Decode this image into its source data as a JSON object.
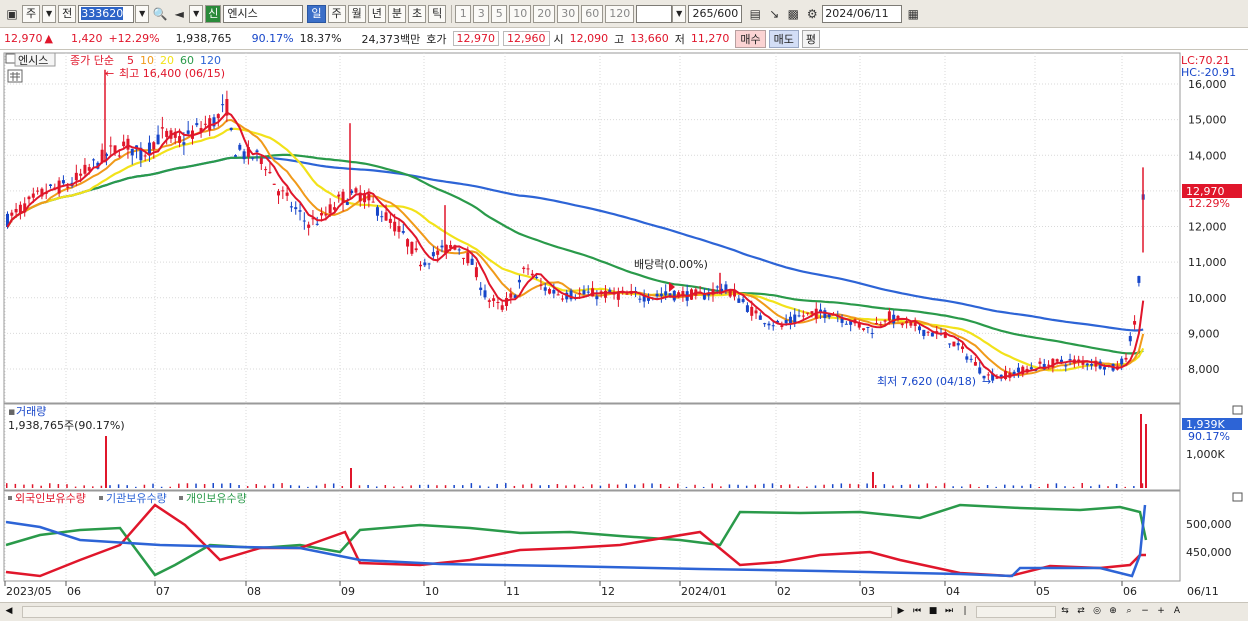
{
  "toolbar": {
    "period_label": "주",
    "prev_label": "전",
    "stock_code": "333620",
    "new_badge": "신",
    "stock_name": "엔시스",
    "periods": [
      "일",
      "주",
      "월",
      "년",
      "분",
      "초",
      "틱"
    ],
    "active_period": "일",
    "intervals": [
      "1",
      "3",
      "5",
      "10",
      "20",
      "30",
      "60",
      "120"
    ],
    "count": "265/600",
    "date": "2024/06/11"
  },
  "quote": {
    "price": "12,970",
    "change": "1,420",
    "change_pct": "+12.29%",
    "volume": "1,938,765",
    "vol_ratio": "90.17%",
    "turnover": "18.37%",
    "amount": "24,373백만",
    "ask_label": "호가",
    "ask1": "12,970",
    "ask2": "12,960",
    "open_label": "시",
    "open": "12,090",
    "high_label": "고",
    "high": "13,660",
    "low_label": "저",
    "low": "11,270",
    "buy_label": "매수",
    "sell_label": "매도",
    "eval_label": "평"
  },
  "price_panel": {
    "name_tag": "엔시스",
    "ma_label": "종가 단순",
    "ma_periods": [
      {
        "label": "5",
        "color": "#e0162b"
      },
      {
        "label": "10",
        "color": "#f09a1a"
      },
      {
        "label": "20",
        "color": "#f2e21a"
      },
      {
        "label": "60",
        "color": "#2a9a4a"
      },
      {
        "label": "120",
        "color": "#2d64d6"
      }
    ],
    "high_note": "최고 16,400 (06/15)",
    "low_note": "최저 7,620 (04/18)",
    "div_note": "배당락(0.00%)",
    "lc_label": "LC:70.21",
    "hc_label": "HC:-20.91",
    "current_tag": "12,970",
    "current_pct": "12.29%",
    "y_ticks": [
      "16,000",
      "15,000",
      "14,000",
      "13,000",
      "12,000",
      "11,000",
      "10,000",
      "9,000",
      "8,000"
    ]
  },
  "volume_panel": {
    "title": "거래량",
    "value_text": "1,938,765주(90.17%)",
    "tag": "1,939K",
    "pct": "90.17%",
    "tick": "1,000K"
  },
  "holdings_panel": {
    "labels": [
      {
        "text": "외국인보유수량",
        "color": "#e0162b"
      },
      {
        "text": "기관보유수량",
        "color": "#2d64d6"
      },
      {
        "text": "개인보유수량",
        "color": "#2a9a4a"
      }
    ],
    "ticks": [
      "500,000",
      "450,000"
    ]
  },
  "x_axis": [
    "2023/05",
    "06",
    "07",
    "08",
    "09",
    "10",
    "11",
    "12",
    "2024/01",
    "02",
    "03",
    "04",
    "05",
    "06",
    "06/11"
  ],
  "colors": {
    "up": "#e0162b",
    "down": "#1746c9",
    "grid": "#d9d9d9"
  }
}
